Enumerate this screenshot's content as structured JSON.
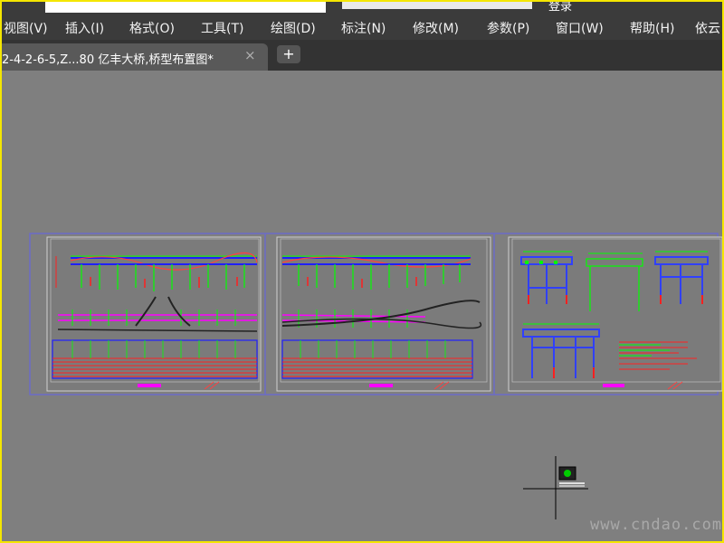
{
  "app": {
    "login_label": "登录"
  },
  "menubar": {
    "items": [
      {
        "label": "视图(V)"
      },
      {
        "label": "插入(I)"
      },
      {
        "label": "格式(O)"
      },
      {
        "label": "工具(T)"
      },
      {
        "label": "绘图(D)"
      },
      {
        "label": "标注(N)"
      },
      {
        "label": "修改(M)"
      },
      {
        "label": "参数(P)"
      },
      {
        "label": "窗口(W)"
      },
      {
        "label": "帮助(H)"
      },
      {
        "label": "依云"
      }
    ]
  },
  "tabs": {
    "active_title": "2-4-2-6-5,Z...80 亿丰大桥,桥型布置图*",
    "close_symbol": "×",
    "new_symbol": "+"
  },
  "canvas": {
    "watermark": "www.cndao.com",
    "sheets": [
      {
        "name": "layout-sheet-1"
      },
      {
        "name": "layout-sheet-2"
      },
      {
        "name": "pier-detail-sheet"
      }
    ]
  },
  "colors": {
    "menubar_bg": "#3b3b3b",
    "canvas_bg": "#7f7f7f",
    "cad_green": "#00ff00",
    "cad_blue": "#2020ff",
    "cad_red": "#ff2020",
    "cad_magenta": "#ff00ff",
    "highlight_border": "#f4e600"
  },
  "icons": {
    "tab_close": "close-icon",
    "tab_new": "plus-icon",
    "cursor": "crosshair-cursor-icon",
    "ucs": "ucs-icon"
  }
}
